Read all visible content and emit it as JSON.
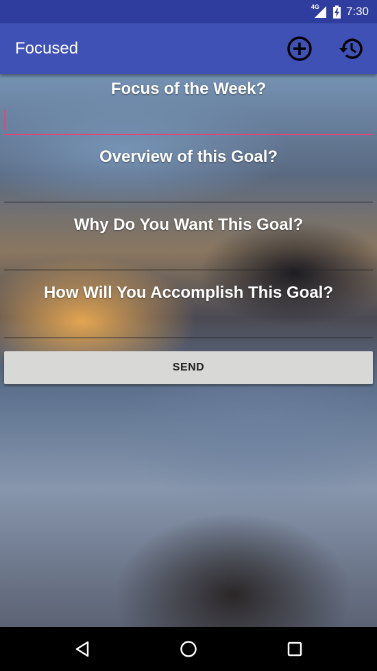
{
  "status_bar": {
    "network": "4G",
    "time": "7:30"
  },
  "app_bar": {
    "title": "Focused",
    "actions": [
      {
        "icon": "add-circle-icon"
      },
      {
        "icon": "history-icon"
      }
    ]
  },
  "form": {
    "fields": [
      {
        "label": "Focus of the Week?",
        "value": "",
        "focused": true
      },
      {
        "label": "Overview of this Goal?",
        "value": "",
        "focused": false
      },
      {
        "label": "Why Do You Want This Goal?",
        "value": "",
        "focused": false
      },
      {
        "label": "How Will You Accomplish This Goal?",
        "value": "",
        "focused": false
      }
    ],
    "send_label": "SEND"
  },
  "colors": {
    "status_bar": "#2f3d9e",
    "app_bar": "#3f51b5",
    "accent": "#e0467a",
    "button": "#d8d8d6"
  },
  "nav_bar": {
    "icons": [
      "back-triangle-icon",
      "home-circle-icon",
      "recents-square-icon"
    ]
  }
}
